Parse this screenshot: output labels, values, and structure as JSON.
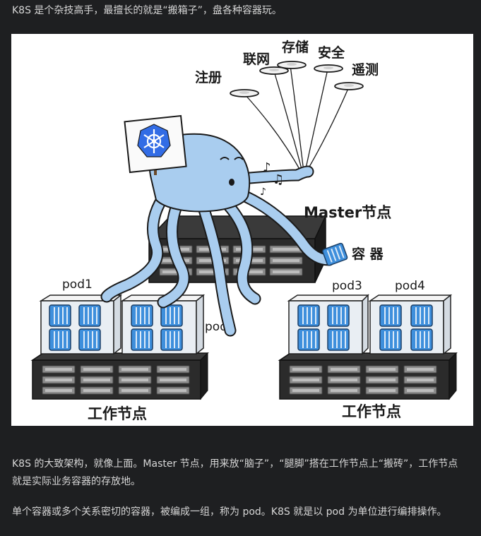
{
  "article": {
    "intro": "K8S 是个杂技高手，最擅长的就是“搬箱子”，盘各种容器玩。",
    "architecture": "K8S 的大致架构，就像上面。Master 节点，用来放“脑子”，“腿脚”搭在工作节点上“搬砖”，工作节点就是实际业务容器的存放地。",
    "pod_definition": "单个容器或多个关系密切的容器，被编成一组，称为 pod。K8S 就是以 pod 为单位进行编排操作。"
  },
  "illustration": {
    "umbrella_labels": [
      "注册",
      "联网",
      "存储",
      "安全",
      "遥测"
    ],
    "master_label": "Master节点",
    "container_label": "容 器",
    "pods": [
      "pod1",
      "pod2",
      "pod3",
      "pod4"
    ],
    "worker_labels": [
      "工作节点",
      "工作节点"
    ],
    "colors": {
      "octopus": "#a9cdef",
      "container": "#3e8fdc",
      "server": "#2b2b2b"
    },
    "icons": [
      "kubernetes-logo-sign",
      "music-notes"
    ]
  }
}
